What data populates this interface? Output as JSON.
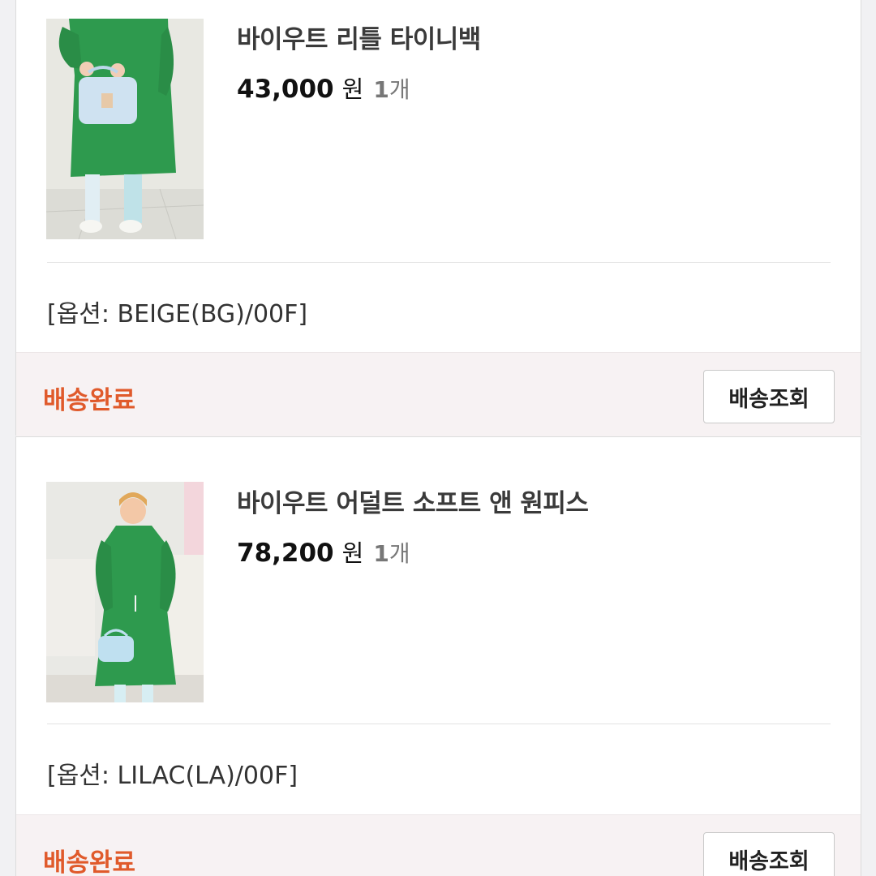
{
  "orders": [
    {
      "product_name": "바이우트 리틀 타이니백",
      "price": "43,000",
      "currency": "원",
      "quantity": "1",
      "quantity_unit": "개",
      "option": "[옵션: BEIGE(BG)/00F]",
      "status": "배송완료",
      "track_button": "배송조회",
      "image_alt": "product photo: green dress with light blue handbag"
    },
    {
      "product_name": "바이우트 어덜트 소프트 앤 원피스",
      "price": "78,200",
      "currency": "원",
      "quantity": "1",
      "quantity_unit": "개",
      "option": "[옵션: LILAC(LA)/00F]",
      "status": "배송완료",
      "track_button": "배송조회",
      "image_alt": "product photo: model in green dress holding blue bag"
    }
  ],
  "colors": {
    "status": "#e05a2b",
    "status_bar_bg": "#f7f2f3",
    "product_green": "#2e9a4e"
  }
}
